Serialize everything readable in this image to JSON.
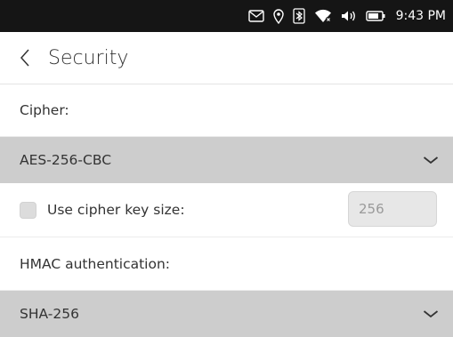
{
  "status_bar": {
    "time": "9:43 PM",
    "icons": [
      "mail-icon",
      "location-icon",
      "bluetooth-icon",
      "wifi-icon",
      "volume-icon",
      "battery-icon"
    ]
  },
  "header": {
    "back_icon": "chevron-left-icon",
    "title": "Security"
  },
  "cipher": {
    "label": "Cipher:",
    "selected": "AES-256-CBC"
  },
  "key_size": {
    "label": "Use cipher key size:",
    "checked": false,
    "value": "256"
  },
  "hmac": {
    "label": "HMAC authentication:",
    "selected": "SHA-256"
  },
  "colors": {
    "status_bar": "#151515",
    "select_background": "#cdcdcd",
    "text": "#333333"
  }
}
